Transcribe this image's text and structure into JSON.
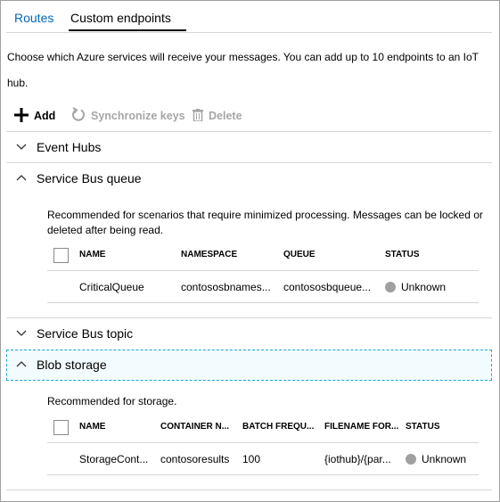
{
  "tabs": [
    {
      "label": "Routes",
      "active": false
    },
    {
      "label": "Custom endpoints",
      "active": true
    }
  ],
  "description": "Choose which Azure services will receive your messages. You can add up to 10 endpoints to an IoT hub.",
  "toolbar": {
    "add_label": "Add",
    "sync_label": "Synchronize keys",
    "delete_label": "Delete"
  },
  "sections": {
    "event_hubs": {
      "title": "Event Hubs",
      "expanded": false
    },
    "sb_queue": {
      "title": "Service Bus queue",
      "expanded": true,
      "description": "Recommended for scenarios that require minimized processing. Messages can be locked or deleted after being read.",
      "columns": [
        "NAME",
        "NAMESPACE",
        "QUEUE",
        "STATUS"
      ],
      "rows": [
        {
          "name": "CriticalQueue",
          "namespace": "contososbnames...",
          "queue": "contososbqueue...",
          "status": "Unknown"
        }
      ]
    },
    "sb_topic": {
      "title": "Service Bus topic",
      "expanded": false
    },
    "blob": {
      "title": "Blob storage",
      "expanded": true,
      "focused": true,
      "description": "Recommended for storage.",
      "columns": [
        "NAME",
        "CONTAINER N...",
        "BATCH FREQU...",
        "FILENAME FOR...",
        "STATUS"
      ],
      "rows": [
        {
          "name": "StorageCont...",
          "container": "contosoresults",
          "batch": "100",
          "filename": "{iothub}/{par...",
          "status": "Unknown"
        }
      ]
    }
  },
  "colors": {
    "link": "#0067b8",
    "disabled": "#a6a6a6",
    "focus_border": "#17a8d6",
    "focus_bg": "#f2fbfd",
    "status_unknown": "#a0a0a0"
  }
}
